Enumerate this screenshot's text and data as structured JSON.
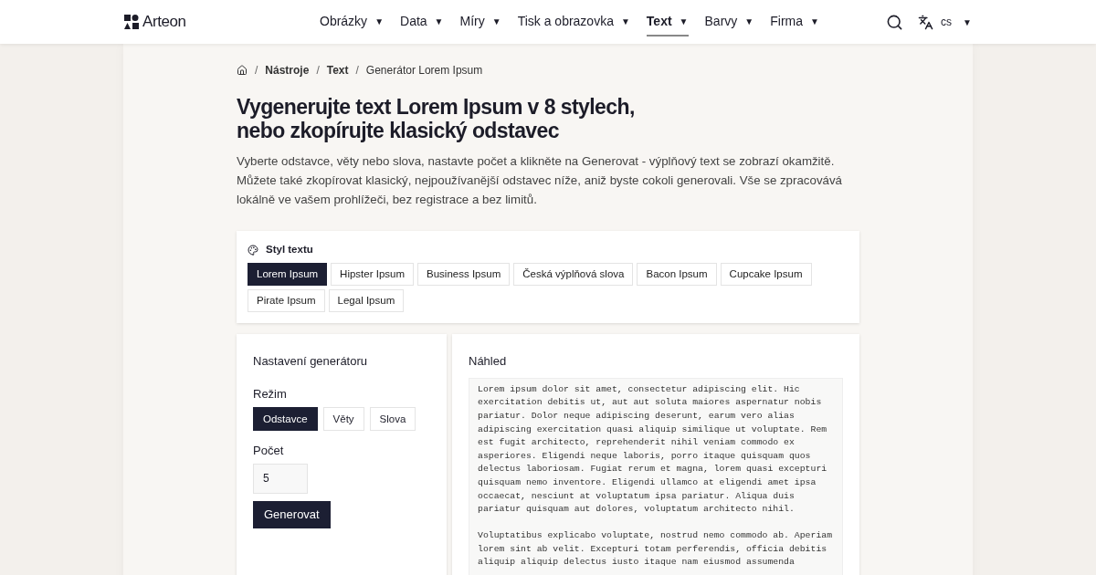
{
  "header": {
    "logo": "Arteon",
    "nav": [
      {
        "label": "Obrázky",
        "selected": false
      },
      {
        "label": "Data",
        "selected": false
      },
      {
        "label": "Míry",
        "selected": false
      },
      {
        "label": "Tisk a obrazovka",
        "selected": false
      },
      {
        "label": "Text",
        "selected": true
      },
      {
        "label": "Barvy",
        "selected": false
      },
      {
        "label": "Firma",
        "selected": false
      }
    ],
    "language": "cs",
    "caret": "▼"
  },
  "breadcrumb": {
    "separator": "/",
    "items": [
      "Nástroje",
      "Text",
      "Generátor Lorem Ipsum"
    ]
  },
  "title_lines": [
    "Vygenerujte text Lorem Ipsum v 8 stylech,",
    "nebo zkopírujte klasický odstavec"
  ],
  "intro": "Vyberte odstavce, věty nebo slova, nastavte počet a klikněte na Generovat - výplňový text se zobrazí okamžitě. Můžete také zkopírovat klasický, nejpoužívanější odstavec níže, aniž byste cokoli generovali. Vše se zpracovává lokálně ve vašem prohlížeči, bez registrace a bez limitů.",
  "style_panel": {
    "title": "Styl textu",
    "styles": [
      {
        "label": "Lorem Ipsum",
        "selected": true
      },
      {
        "label": "Hipster Ipsum",
        "selected": false
      },
      {
        "label": "Business Ipsum",
        "selected": false
      },
      {
        "label": "Česká výplňová slova",
        "selected": false
      },
      {
        "label": "Bacon Ipsum",
        "selected": false
      },
      {
        "label": "Cupcake Ipsum",
        "selected": false
      },
      {
        "label": "Pirate Ipsum",
        "selected": false
      },
      {
        "label": "Legal Ipsum",
        "selected": false
      }
    ]
  },
  "settings": {
    "title": "Nastavení generátoru",
    "mode_label": "Režim",
    "modes": [
      {
        "label": "Odstavce",
        "selected": true
      },
      {
        "label": "Věty",
        "selected": false
      },
      {
        "label": "Slova",
        "selected": false
      }
    ],
    "count_label": "Počet",
    "count": "5",
    "generate": "Generovat"
  },
  "preview": {
    "title": "Náhled",
    "paragraphs": [
      "Lorem ipsum dolor sit amet, consectetur adipiscing elit. Hic exercitation debitis ut, aut aut soluta maiores aspernatur nobis pariatur. Dolor neque adipiscing deserunt, earum vero alias adipiscing exercitation quasi aliquip similique ut voluptate. Rem est fugit architecto, reprehenderit nihil veniam commodo ex asperiores. Eligendi neque laboris, porro itaque quisquam quos delectus laboriosam. Fugiat rerum et magna, lorem quasi excepturi quisquam nemo inventore. Eligendi ullamco at eligendi amet ipsa occaecat, nesciunt at voluptatum ipsa pariatur. Aliqua duis pariatur quisquam aut dolores, voluptatum architecto nihil.",
      "Voluptatibus explicabo voluptate, nostrud nemo commodo ab. Aperiam lorem sint ab velit. Excepturi totam perferendis, officia debitis aliquip aliquip delectus iusto itaque nam eiusmod assumenda"
    ]
  }
}
